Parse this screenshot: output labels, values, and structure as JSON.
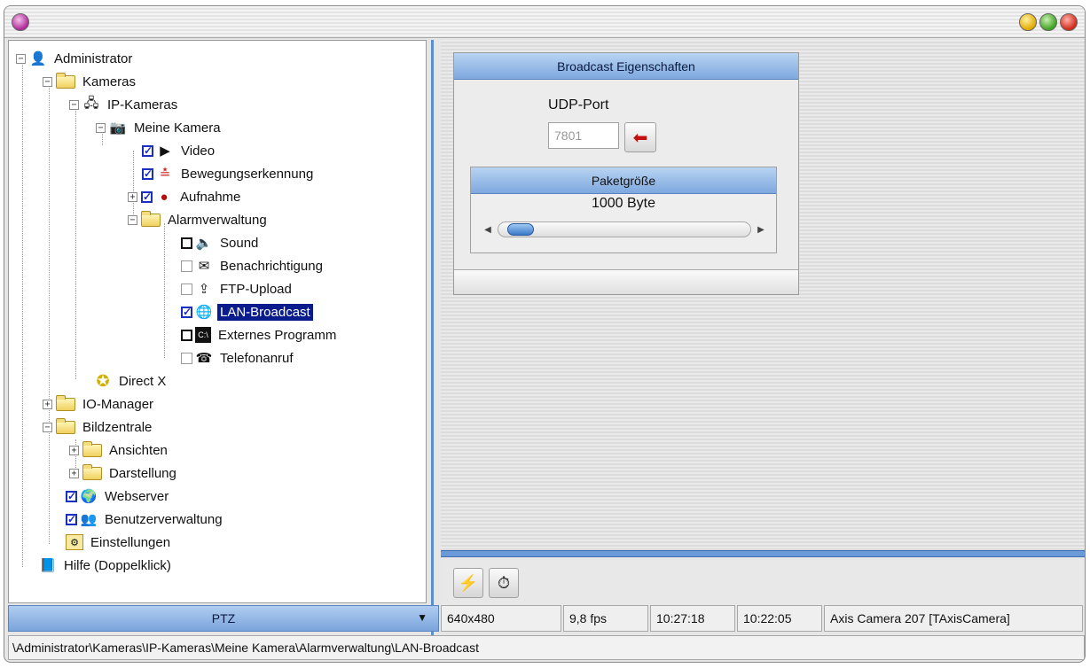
{
  "tree": {
    "items": [
      {
        "label": "Administrator"
      },
      {
        "label": "Kameras"
      },
      {
        "label": "IP-Kameras"
      },
      {
        "label": "Meine Kamera"
      },
      {
        "label": "Video"
      },
      {
        "label": "Bewegungserkennung"
      },
      {
        "label": "Aufnahme"
      },
      {
        "label": "Alarmverwaltung"
      },
      {
        "label": "Sound"
      },
      {
        "label": "Benachrichtigung"
      },
      {
        "label": "FTP-Upload"
      },
      {
        "label": "LAN-Broadcast"
      },
      {
        "label": "Externes Programm"
      },
      {
        "label": "Telefonanruf"
      },
      {
        "label": "Direct X"
      },
      {
        "label": "IO-Manager"
      },
      {
        "label": "Bildzentrale"
      },
      {
        "label": "Ansichten"
      },
      {
        "label": "Darstellung"
      },
      {
        "label": "Webserver"
      },
      {
        "label": "Benutzerverwaltung"
      },
      {
        "label": "Einstellungen"
      },
      {
        "label": "Hilfe (Doppelklick)"
      }
    ],
    "selected": "LAN-Broadcast"
  },
  "broadcast": {
    "title": "Broadcast Eigenschaften",
    "udp_label": "UDP-Port",
    "udp_value": "7801",
    "packet_title": "Paketgröße",
    "packet_value": "1000 Byte",
    "slider_position": 0.03
  },
  "ptz": {
    "label": "PTZ"
  },
  "status": {
    "resolution": "640x480",
    "fps": "9,8 fps",
    "time1": "10:27:18",
    "time2": "10:22:05",
    "camera": "Axis Camera 207 [TAxisCamera]"
  },
  "path": "\\Administrator\\Kameras\\IP-Kameras\\Meine Kamera\\Alarmverwaltung\\LAN-Broadcast",
  "colors": {
    "selection": "#0a1c8c",
    "accent_blue": "#7ea8de",
    "check_blue": "#1a2fbf"
  }
}
